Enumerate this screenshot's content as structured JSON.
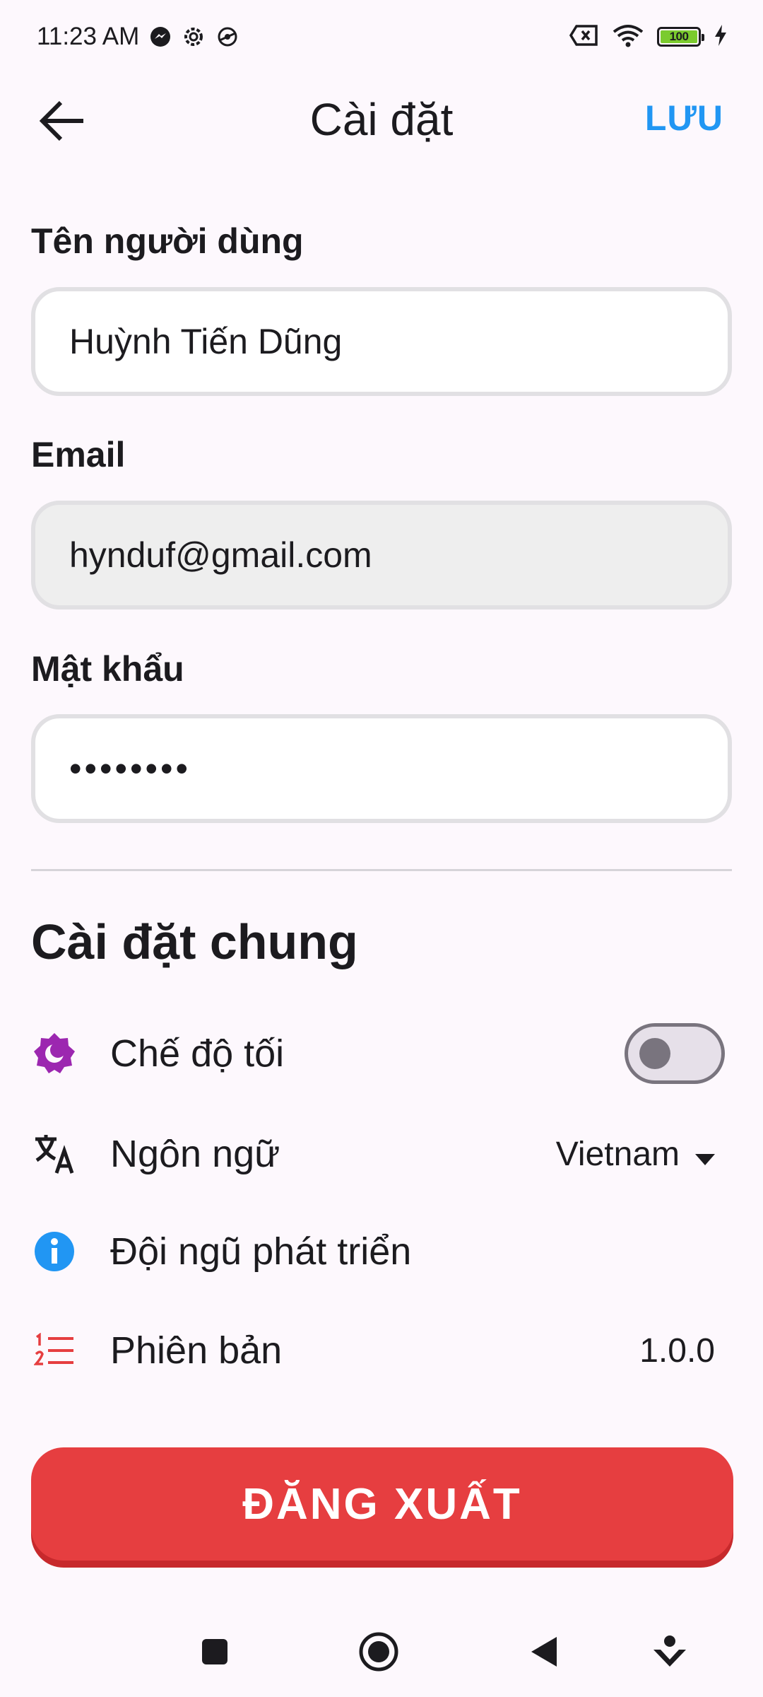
{
  "status_bar": {
    "time": "11:23 AM",
    "battery_level": "100",
    "icons": [
      "messenger-icon",
      "settings-gear-icon",
      "vpn-icon",
      "sim-off-icon",
      "wifi-icon",
      "battery-icon",
      "charging-icon"
    ]
  },
  "app_bar": {
    "title": "Cài đặt",
    "save_label": "LƯU",
    "accent_color": "#2196F3"
  },
  "account": {
    "username_label": "Tên người dùng",
    "username_value": "Huỳnh Tiến Dũng",
    "email_label": "Email",
    "email_value": "hynduf@gmail.com",
    "password_label": "Mật khẩu",
    "password_value": "••••••••"
  },
  "general": {
    "title": "Cài đặt chung",
    "dark_mode_label": "Chế độ tối",
    "dark_mode_enabled": false,
    "language_label": "Ngôn ngữ",
    "language_value": "Vietnam",
    "team_label": "Đội ngũ phát triển",
    "version_label": "Phiên bản",
    "version_value": "1.0.0"
  },
  "logout": {
    "label": "ĐĂNG XUẤT",
    "color": "#E63E40"
  }
}
